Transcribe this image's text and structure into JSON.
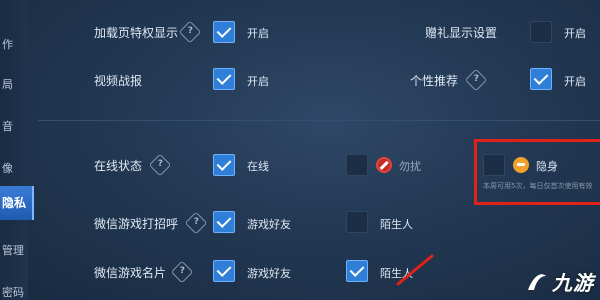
{
  "sidebar": {
    "items": [
      {
        "label": "作"
      },
      {
        "label": "局"
      },
      {
        "label": "音"
      },
      {
        "label": "像"
      },
      {
        "label": "隐私"
      },
      {
        "label": "管理"
      },
      {
        "label": "密码"
      }
    ]
  },
  "settings": {
    "loading_privilege": {
      "label": "加载页特权显示",
      "option": "开启"
    },
    "gift_display": {
      "label": "赠礼显示设置",
      "option": "开启"
    },
    "video_report": {
      "label": "视频战报",
      "option": "开启"
    },
    "personal_recommend": {
      "label": "个性推荐",
      "option": "开启"
    },
    "online_status": {
      "label": "在线状态",
      "opt_online": "在线",
      "opt_busy": "勿扰",
      "opt_hidden": "隐身",
      "hint": "本周可用5次，每日仅首次使用有效"
    },
    "wechat_greet": {
      "label": "微信游戏打招呼",
      "opt_friends": "游戏好友",
      "opt_strangers": "陌生人"
    },
    "wechat_card": {
      "label": "微信游戏名片",
      "opt_friends": "游戏好友",
      "opt_strangers": "陌生人"
    }
  },
  "help_glyph": "?",
  "watermark": {
    "text": "九游",
    "icon": "swoosh-icon"
  },
  "colors": {
    "accent": "#2f7fd9",
    "highlight_box": "#e0221a",
    "busy_icon": "#c52b24",
    "hidden_icon": "#f0a12a"
  }
}
